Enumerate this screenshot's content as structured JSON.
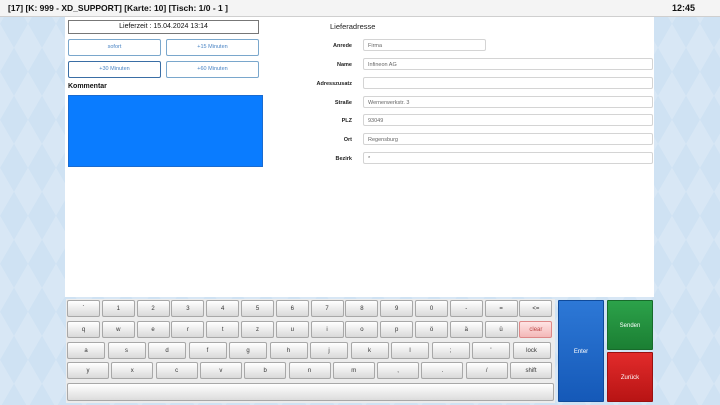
{
  "titlebar": {
    "title": "[17] [K: 999 - XD_SUPPORT] [Karte: 10] [Tisch: 1/0 - 1 ]",
    "clock": "12:45"
  },
  "lieferzeit": "Lieferzeit : 15.04.2024 13:14",
  "time_buttons": [
    "sofort",
    "+15 Minuten",
    "+30 Minuten",
    "+60 Minuten"
  ],
  "kommentar_label": "Kommentar",
  "lieferadresse": {
    "heading": "Lieferadresse",
    "fields": [
      {
        "label": "Anrede",
        "value": "Firma"
      },
      {
        "label": "Name",
        "value": "Infineon AG"
      },
      {
        "label": "Adresszusatz",
        "value": ""
      },
      {
        "label": "Straße",
        "value": "Wernerwerkstr. 3"
      },
      {
        "label": "PLZ",
        "value": "93049"
      },
      {
        "label": "Ort",
        "value": "Regensburg"
      },
      {
        "label": "Bezirk",
        "value": "*"
      }
    ]
  },
  "keyboard": {
    "rows": [
      [
        "`",
        "1",
        "2",
        "3",
        "4",
        "5",
        "6",
        "7",
        "8",
        "9",
        "0",
        "-",
        "=",
        "<="
      ],
      [
        "q",
        "w",
        "e",
        "r",
        "t",
        "z",
        "u",
        "i",
        "o",
        "p",
        "ö",
        "ä",
        "ü",
        "clear"
      ],
      [
        "a",
        "s",
        "d",
        "f",
        "g",
        "h",
        "j",
        "k",
        "l",
        ";",
        "'",
        "lock"
      ],
      [
        "y",
        "x",
        "c",
        "v",
        "b",
        "n",
        "m",
        ",",
        ".",
        "/",
        "shift"
      ]
    ]
  },
  "actions": {
    "enter": "Enter",
    "senden": "Senden",
    "zurueck": "Zurück"
  },
  "colors": {
    "enter": "#1f6fd0",
    "senden": "#23923f",
    "zurueck": "#d21f1f",
    "kommentar": "#0a7cff"
  }
}
